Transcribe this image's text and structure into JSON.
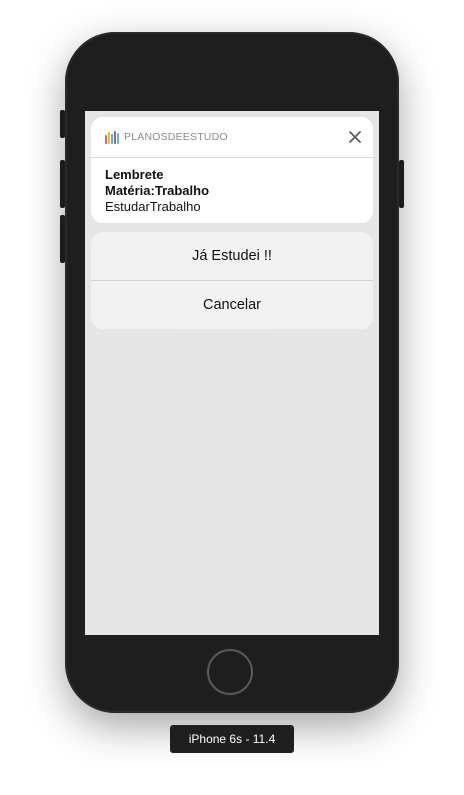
{
  "notification": {
    "app_name": "PLANOSDEESTUDO",
    "close_icon": "close-icon",
    "title": "Lembrete",
    "subtitle": "Matéria:Trabalho",
    "body": "EstudarTrabalho"
  },
  "actions": {
    "primary_label": "Já Estudei !!",
    "cancel_label": "Cancelar"
  },
  "device": {
    "label": "iPhone 6s - 11.4"
  },
  "colors": {
    "phone_body": "#1e1e1e",
    "screen_bg": "#e6e6e6",
    "card_bg": "#ffffff",
    "action_bg": "#f2f2f2"
  }
}
